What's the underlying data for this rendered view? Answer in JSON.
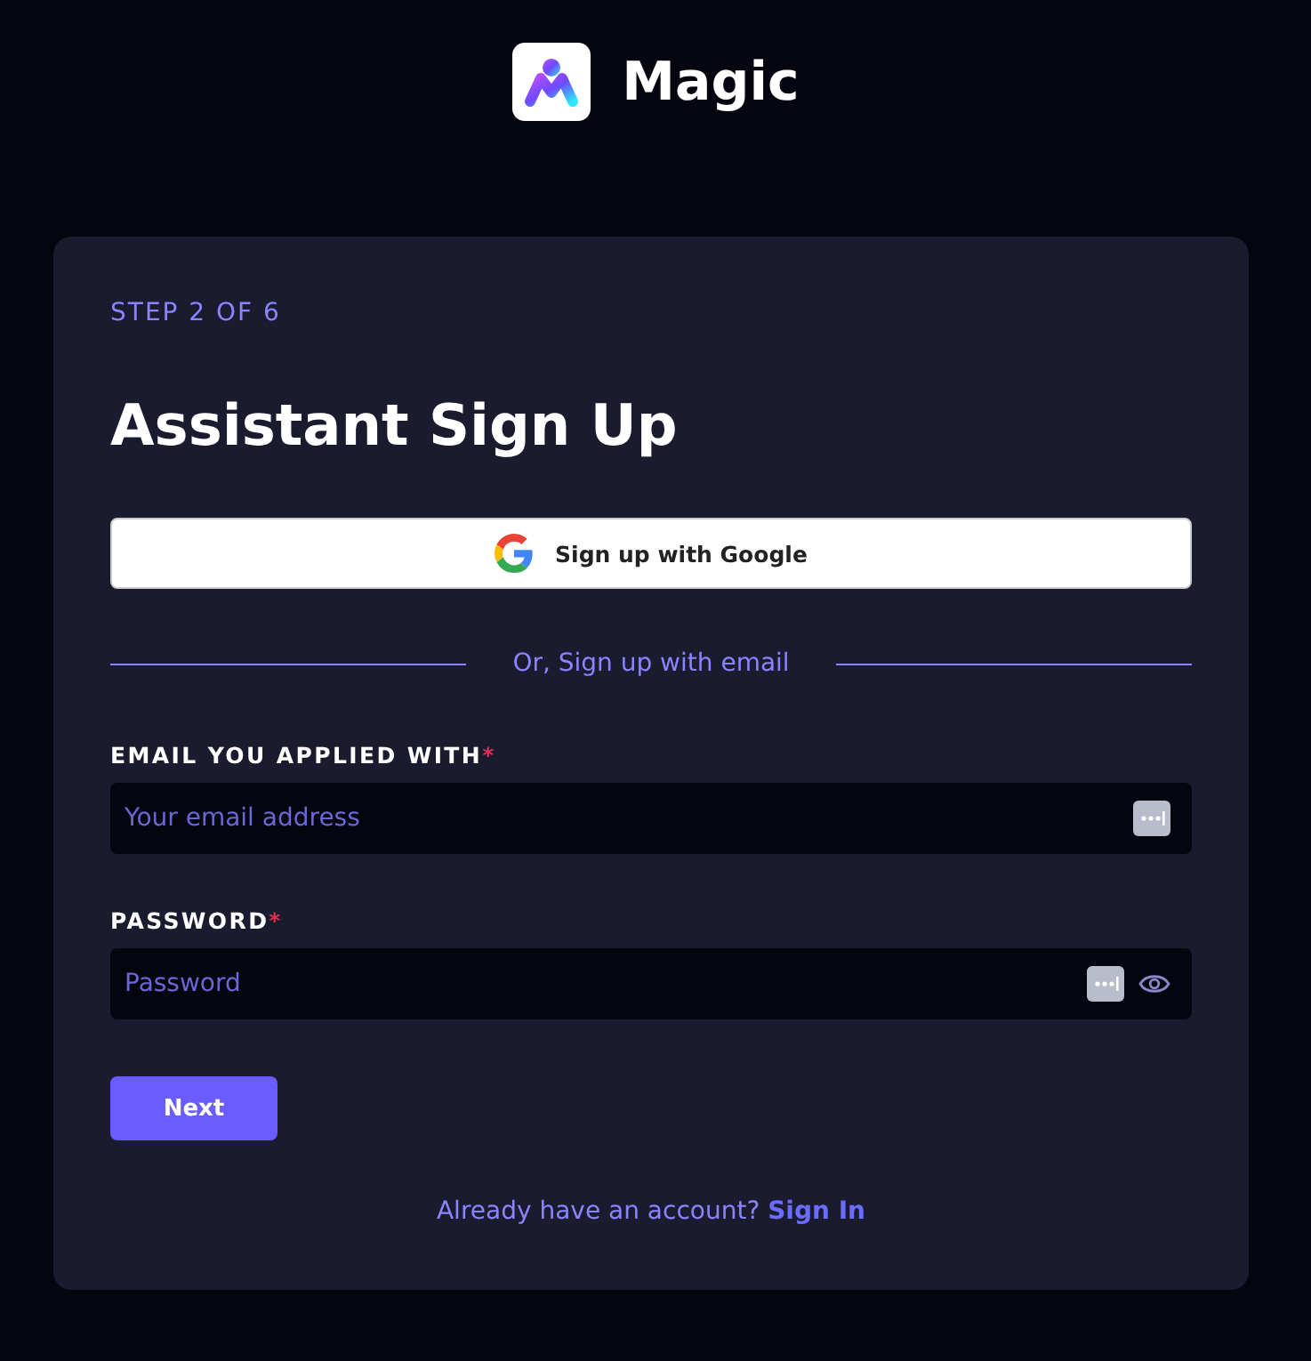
{
  "brand": {
    "name": "Magic"
  },
  "card": {
    "step": "STEP 2 OF 6",
    "title": "Assistant Sign Up",
    "google_button": "Sign up with Google",
    "divider_text": "Or, Sign up with email",
    "fields": [
      {
        "label": "EMAIL YOU APPLIED WITH",
        "required_mark": "*",
        "placeholder": "Your email address",
        "kind": "email"
      },
      {
        "label": "PASSWORD",
        "required_mark": "*",
        "placeholder": "Password",
        "kind": "password"
      }
    ],
    "next_button": "Next",
    "footer": {
      "text": "Already have an account?",
      "link": "Sign In"
    }
  }
}
